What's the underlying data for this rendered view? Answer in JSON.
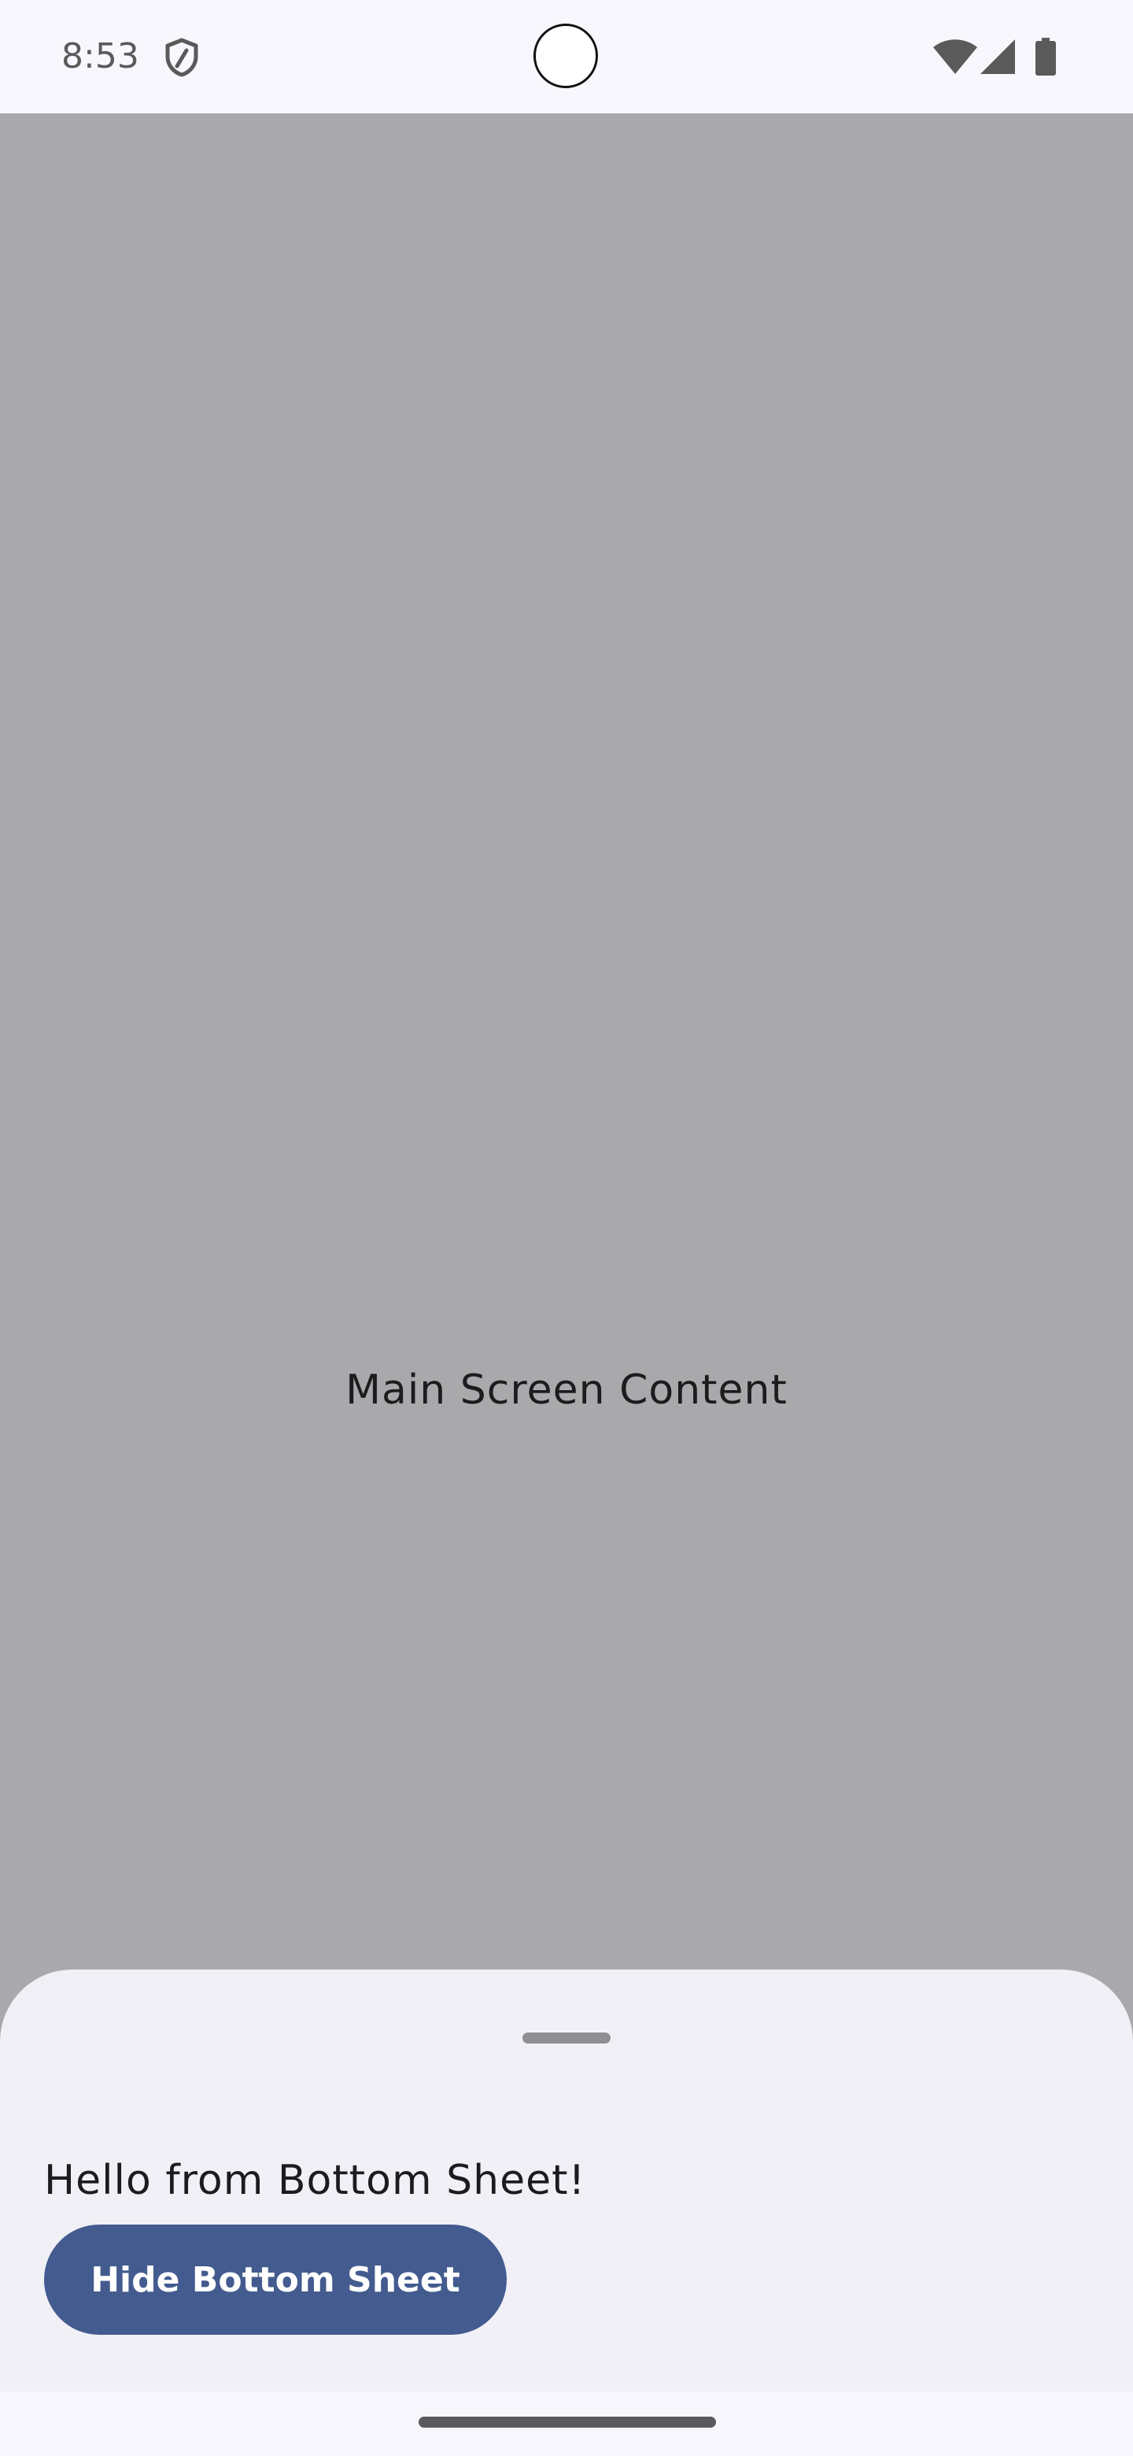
{
  "status_bar": {
    "time": "8:53",
    "icons": [
      "shield-icon",
      "wifi-icon",
      "signal-icon",
      "battery-icon"
    ]
  },
  "main": {
    "content_text": "Main Screen Content"
  },
  "bottom_sheet": {
    "message": "Hello from Bottom Sheet!",
    "hide_button_label": "Hide Bottom Sheet"
  },
  "colors": {
    "scrim": "#a9a9ab",
    "sheet_background": "#f1f0f7",
    "button_background": "#435b8f",
    "button_text": "#ffffff"
  }
}
